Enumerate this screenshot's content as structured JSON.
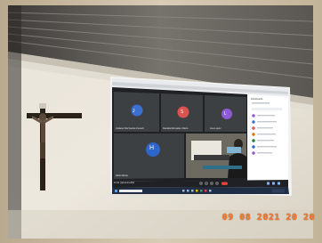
{
  "scene": {
    "timestamp": "09 08 2021 20 20"
  },
  "meeting": {
    "participants": [
      {
        "initial": "J",
        "color": "#3b6fd1",
        "name": "Jiuliana Vila Santos Fenech"
      },
      {
        "initial": "S",
        "color": "#d9534f",
        "name": "Daniela Monsalve Olarte"
      },
      {
        "initial": "L",
        "color": "#8e5ad6",
        "name": "Lisa Lopez"
      },
      {
        "initial": "H",
        "color": "#2f66c9",
        "name": "Hélio Moran"
      }
    ],
    "status_text": "11:11 | ijd-wxsn-dhd",
    "side_panel": {
      "title": "Participants",
      "items": [
        "",
        "",
        "",
        "",
        "",
        "",
        ""
      ]
    },
    "colors": {
      "wall": "#e8e3d8",
      "ceiling": "#6d6a66",
      "meet_bg": "#202124",
      "taskbar": "#1f2d45",
      "end_call": "#ea4335"
    }
  }
}
